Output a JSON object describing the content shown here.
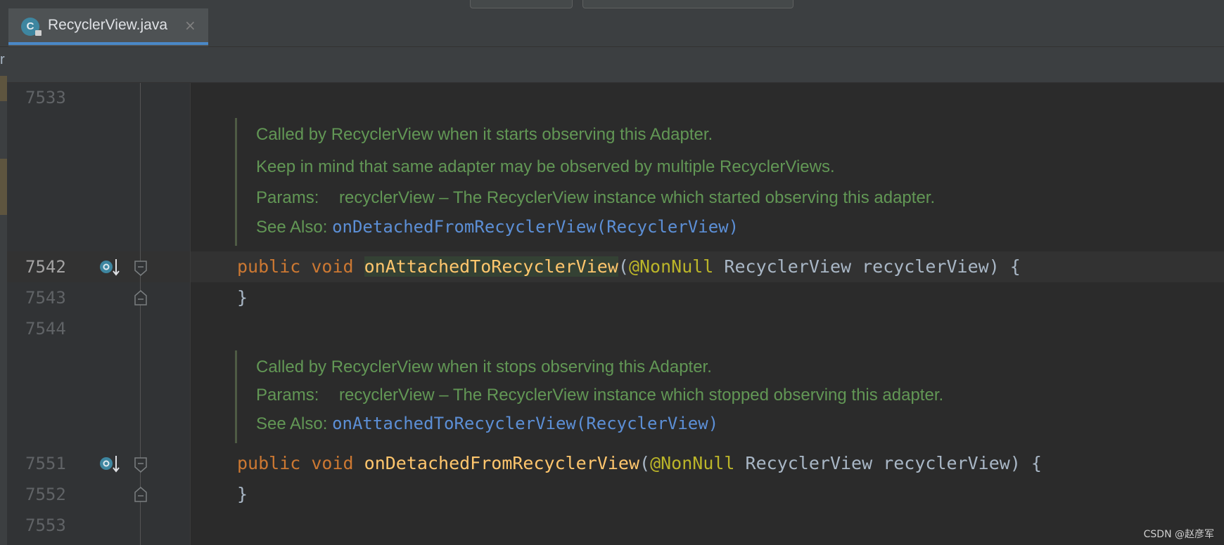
{
  "editor": {
    "tab": {
      "filename": "RecyclerView.java",
      "icon_letter": "C",
      "close_glyph": "×"
    },
    "left_edge_text": "r"
  },
  "line_numbers": {
    "l7533": "7533",
    "l7542": "7542",
    "l7543": "7543",
    "l7544": "7544",
    "l7551": "7551",
    "l7552": "7552",
    "l7553": "7553"
  },
  "doc1": {
    "line1": "Called by RecyclerView when it starts observing this Adapter.",
    "line2": "Keep in mind that same adapter may be observed by multiple RecyclerViews.",
    "params_label": "Params:",
    "params_text": "recyclerView – The RecyclerView instance which started observing this adapter.",
    "see_also_label": "See Also:",
    "see_also_link": "onDetachedFromRecyclerView(RecyclerView)"
  },
  "method1": {
    "kw_public": "public",
    "kw_void": "void",
    "name": "onAttachedToRecyclerView",
    "paren_open": "(",
    "annotation": "@NonNull",
    "params": " RecyclerView recyclerView) {",
    "close": "}"
  },
  "doc2": {
    "line1": "Called by RecyclerView when it stops observing this Adapter.",
    "params_label": "Params:",
    "params_text": "recyclerView – The RecyclerView instance which stopped observing this adapter.",
    "see_also_label": "See Also:",
    "see_also_link": "onAttachedToRecyclerView(RecyclerView)"
  },
  "method2": {
    "kw_public": "public",
    "kw_void": "void",
    "name": "onDetachedFromRecyclerView",
    "paren_open": "(",
    "annotation": "@NonNull",
    "params": " RecyclerView recyclerView) {",
    "close": "}"
  },
  "gutter_icons": [
    "override-method-icon",
    "fold-start-icon",
    "fold-end-icon"
  ],
  "watermark": "CSDN @赵彦军",
  "colors": {
    "background": "#2b2b2b",
    "keyword": "#cc7832",
    "method": "#ffc66d",
    "annotation": "#bbb529",
    "doc_text": "#629755",
    "doc_link": "#5c8fd6",
    "tab_underline": "#4a88c7"
  }
}
